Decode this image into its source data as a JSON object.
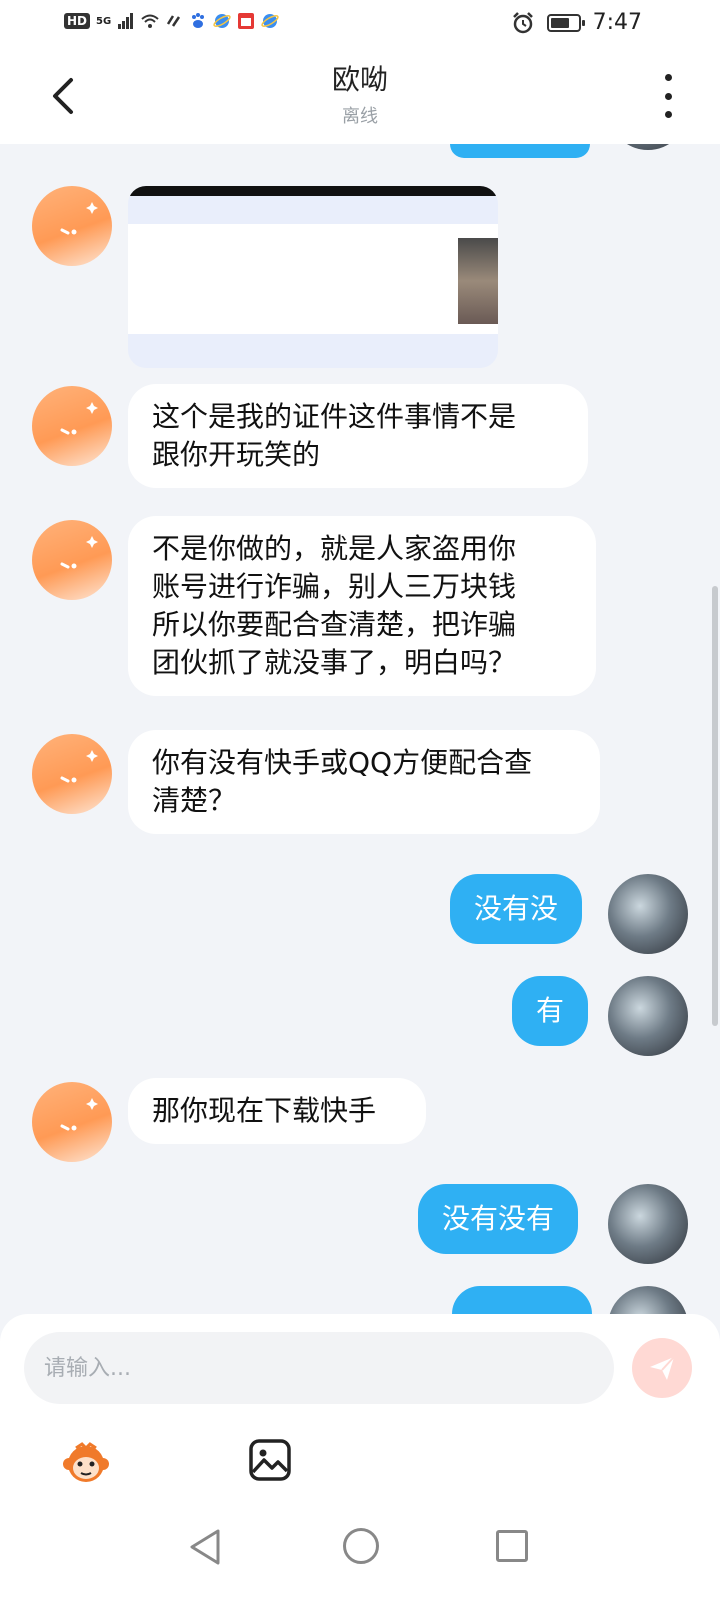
{
  "status_bar": {
    "hd_label": "HD",
    "network_label": "5G",
    "time": "7:47",
    "battery_percent": 70
  },
  "header": {
    "title": "欧呦",
    "subtitle": "离线"
  },
  "messages": [
    {
      "side": "right",
      "text": ""
    },
    {
      "side": "left",
      "type": "image"
    },
    {
      "side": "left",
      "text_lines": [
        "这个是我的证件这件事情不是",
        "跟你开玩笑的"
      ]
    },
    {
      "side": "left",
      "text_lines": [
        "不是你做的，就是人家盗用你",
        "账号进行诈骗，别人三万块钱",
        "所以你要配合查清楚，把诈骗",
        "团伙抓了就没事了，明白吗？"
      ]
    },
    {
      "side": "left",
      "text_lines": [
        "你有没有快手或QQ方便配合查",
        "清楚？"
      ]
    },
    {
      "side": "right",
      "text": "没有没"
    },
    {
      "side": "right",
      "text": "有"
    },
    {
      "side": "left",
      "text_lines": [
        "那你现在下载快手"
      ]
    },
    {
      "side": "right",
      "text": "没有没有"
    },
    {
      "side": "right",
      "text": ""
    }
  ],
  "input": {
    "placeholder": "请输入..."
  },
  "icons": {
    "back": "chevron-left-icon",
    "more": "more-vertical-icon",
    "send": "send-icon",
    "emoji": "monkey-emoji-icon",
    "image": "image-icon"
  },
  "colors": {
    "accent": "#2fb0f3",
    "send_disabled": "#ffd9d4",
    "avatar_orange": "#ff9a55"
  }
}
